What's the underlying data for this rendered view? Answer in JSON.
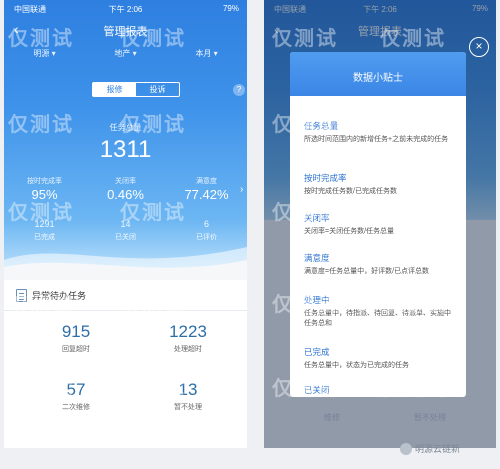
{
  "status_bar": {
    "carrier": "中国联通",
    "time": "下午 2:06",
    "battery": "79%"
  },
  "left": {
    "nav_title": "管理报表",
    "filters": [
      "明源 ▾",
      "地产 ▾",
      "本月 ▾"
    ],
    "segment": {
      "active": "报修",
      "inactive": "投诉"
    },
    "help_icon": "?",
    "total": {
      "label": "任务总量",
      "value": "1311"
    },
    "metrics": [
      {
        "label": "按时完成率",
        "value": "95%",
        "count": "1291",
        "small": "已完成"
      },
      {
        "label": "关闭率",
        "value": "0.46%",
        "count": "14",
        "small": "已关闭"
      },
      {
        "label": "满意度",
        "value": "77.42%",
        "count": "6",
        "small": "已评价"
      }
    ],
    "abnormal_card": {
      "title": "异常待办任务",
      "stats": [
        {
          "value": "915",
          "label": "回复超时"
        },
        {
          "value": "1223",
          "label": "处理超时"
        },
        {
          "value": "57",
          "label": "二次维修"
        },
        {
          "value": "13",
          "label": "暂不处理"
        }
      ]
    }
  },
  "right": {
    "nav_title": "管理报表",
    "bg_labels": [
      "维修",
      "暂不处理"
    ],
    "modal": {
      "title": "数据小贴士",
      "close_icon": "×",
      "terms": [
        {
          "title": "任务总量",
          "desc": "所选时间范围内的新增任务+之前未完成的任务"
        },
        {
          "title": "按时完成率",
          "desc": "按时完成任务数/已完成任务数"
        },
        {
          "title": "关闭率",
          "desc": "关闭率=关闭任务数/任务总量"
        },
        {
          "title": "满意度",
          "desc": "满意度=任务总量中，好评数/已点评总数"
        },
        {
          "title": "处理中",
          "desc": "任务总量中，待指派、待回复、待派单、实施中任务总和"
        },
        {
          "title": "已完成",
          "desc": "任务总量中，状态为已完成的任务"
        },
        {
          "title": "已关闭",
          "desc": ""
        }
      ]
    }
  },
  "watermark_text": "仅测试",
  "credit": "明源云链新"
}
